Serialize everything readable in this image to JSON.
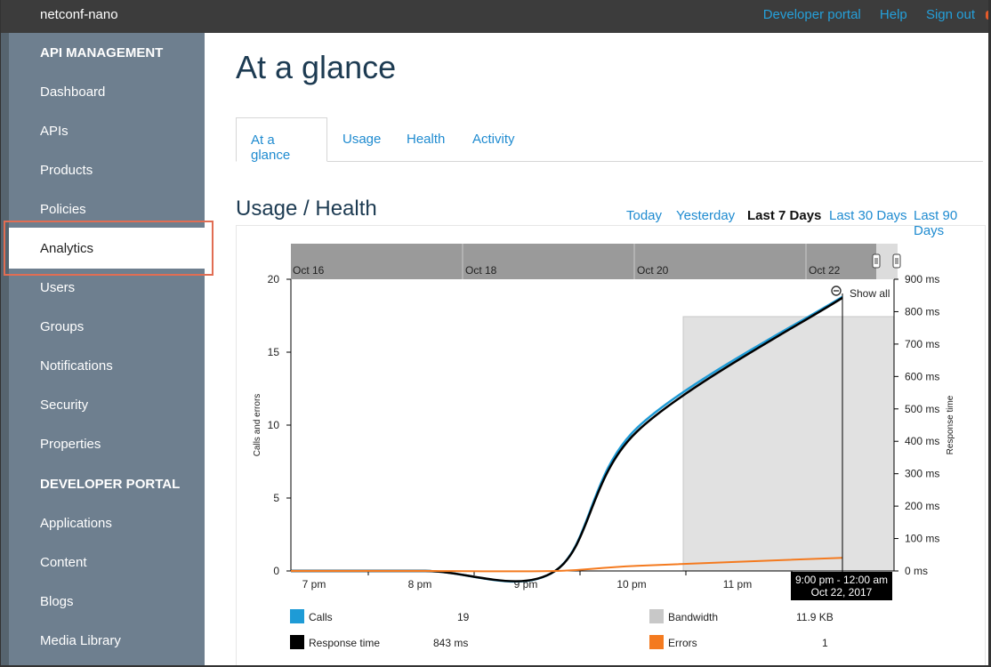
{
  "topbar": {
    "app_name": "netconf-nano",
    "links": [
      "Developer portal",
      "Help",
      "Sign out"
    ]
  },
  "sidebar": {
    "sections": [
      {
        "label": "API MANAGEMENT",
        "header": true
      },
      {
        "label": "Dashboard"
      },
      {
        "label": "APIs"
      },
      {
        "label": "Products"
      },
      {
        "label": "Policies"
      },
      {
        "label": "Analytics",
        "selected": true
      },
      {
        "label": "Users"
      },
      {
        "label": "Groups"
      },
      {
        "label": "Notifications"
      },
      {
        "label": "Security"
      },
      {
        "label": "Properties"
      },
      {
        "label": "DEVELOPER PORTAL",
        "header": true
      },
      {
        "label": "Applications"
      },
      {
        "label": "Content"
      },
      {
        "label": "Blogs"
      },
      {
        "label": "Media Library"
      }
    ]
  },
  "main": {
    "title": "At a glance",
    "tabs": [
      {
        "label": "At a glance",
        "active": true
      },
      {
        "label": "Usage"
      },
      {
        "label": "Health"
      },
      {
        "label": "Activity"
      }
    ],
    "section_title": "Usage / Health",
    "time_ranges": [
      {
        "label": "Today"
      },
      {
        "label": "Yesterday"
      },
      {
        "label": "Last 7 Days",
        "active": true
      },
      {
        "label": "Last 30 Days"
      },
      {
        "label": "Last 90 Days"
      }
    ]
  },
  "chart_data": {
    "type": "line",
    "navigator_labels": [
      "Oct 16",
      "Oct 18",
      "Oct 20",
      "Oct 22"
    ],
    "x_ticks": [
      "7 pm",
      "8 pm",
      "9 pm",
      "10 pm",
      "11 pm"
    ],
    "ylabel_left": "Calls and errors",
    "ylabel_right": "Response time",
    "ylim_left": [
      0,
      20
    ],
    "yticks_left": [
      "0",
      "5",
      "10",
      "15",
      "20"
    ],
    "ylim_right": [
      0,
      900
    ],
    "yticks_right": [
      "0 ms",
      "100 ms",
      "200 ms",
      "300 ms",
      "400 ms",
      "500 ms",
      "600 ms",
      "700 ms",
      "800 ms",
      "900 ms"
    ],
    "show_all_label": "Show all",
    "tooltip": {
      "line1": "9:00 pm - 12:00 am",
      "line2": "Oct 22, 2017"
    },
    "series": [
      {
        "name": "Calls",
        "color": "#1e9bd6",
        "axis": "left",
        "points": [
          [
            0,
            0
          ],
          [
            1,
            0
          ],
          [
            2,
            0
          ],
          [
            3,
            9.8
          ],
          [
            4,
            18.8
          ]
        ]
      },
      {
        "name": "Response time",
        "color": "#000000",
        "axis": "right",
        "points": [
          [
            0,
            0
          ],
          [
            1,
            0
          ],
          [
            2,
            0
          ],
          [
            3,
            430
          ],
          [
            4,
            843
          ]
        ]
      },
      {
        "name": "Errors",
        "color": "#f47a1f",
        "axis": "left",
        "points": [
          [
            0,
            0
          ],
          [
            1,
            0
          ],
          [
            2,
            0
          ],
          [
            3,
            0.35
          ],
          [
            4,
            0.9
          ]
        ]
      },
      {
        "name": "Bandwidth",
        "color": "#c8c8c8",
        "axis": "left"
      }
    ],
    "legend": [
      {
        "name": "Calls",
        "color": "#1e9bd6",
        "value": "19"
      },
      {
        "name": "Response time",
        "color": "#000000",
        "value": "843 ms"
      },
      {
        "name": "Bandwidth",
        "color": "#c8c8c8",
        "value": "11.9 KB"
      },
      {
        "name": "Errors",
        "color": "#f47a1f",
        "value": "1"
      }
    ]
  }
}
